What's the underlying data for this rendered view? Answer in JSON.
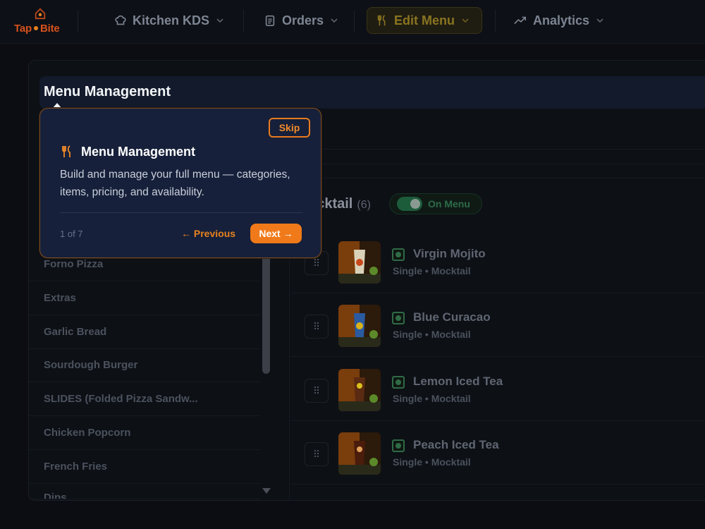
{
  "brand": {
    "part1": "Tap",
    "part2": "Bite"
  },
  "nav": {
    "items": [
      {
        "label": "Kitchen KDS",
        "icon": "chef-hat-icon"
      },
      {
        "label": "Orders",
        "icon": "clipboard-icon"
      },
      {
        "label": "Edit Menu",
        "icon": "utensils-icon",
        "active": true
      },
      {
        "label": "Analytics",
        "icon": "trending-up-icon"
      }
    ]
  },
  "page": {
    "title": "Menu Management"
  },
  "categories": [
    "Forno Pizza",
    "Extras",
    "Garlic Bread",
    "Sourdough Burger",
    "SLIDES (Folded Pizza Sandw...",
    "Chicken Popcorn",
    "French Fries",
    "Dips"
  ],
  "category_panel": {
    "name": "ocktail",
    "count": "(6)",
    "toggle_label": "On Menu"
  },
  "items": [
    {
      "name": "Virgin Mojito",
      "meta": "Single • Mocktail"
    },
    {
      "name": "Blue Curacao",
      "meta": "Single • Mocktail"
    },
    {
      "name": "Lemon Iced Tea",
      "meta": "Single • Mocktail"
    },
    {
      "name": "Peach Iced Tea",
      "meta": "Single • Mocktail"
    }
  ],
  "tour": {
    "skip": "Skip",
    "title": "Menu Management",
    "description": "Build and manage your full menu — categories, items, pricing, and availability.",
    "step": "1 of 7",
    "previous": "← Previous",
    "next": "Next →"
  },
  "colors": {
    "accent": "#f07a1a",
    "veg": "#2f6b46",
    "popover_bg": "#16203a"
  }
}
